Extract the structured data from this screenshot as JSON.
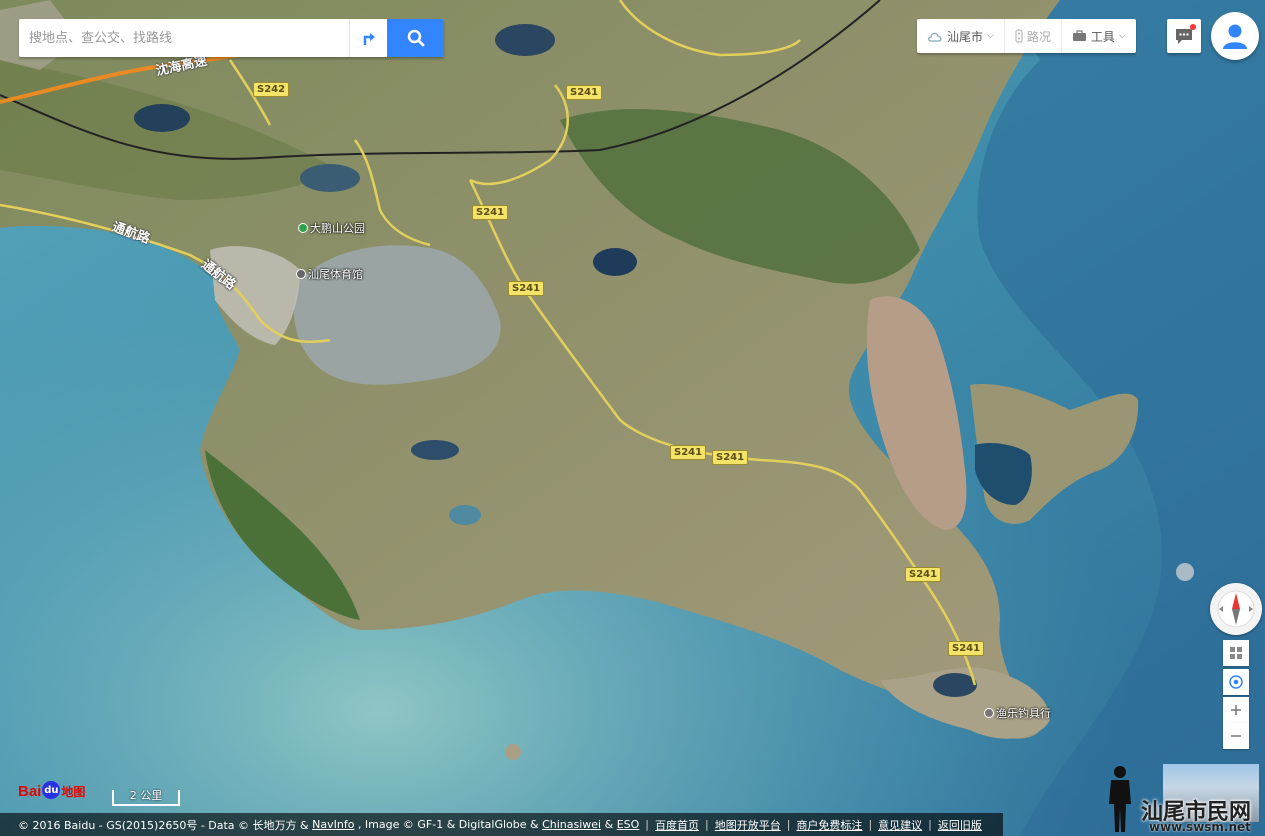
{
  "search": {
    "placeholder": "搜地点、查公交、找路线"
  },
  "toolbar": {
    "city": "汕尾市",
    "traffic": "路况",
    "tools": "工具"
  },
  "map": {
    "road_shields": [
      "S242",
      "S241",
      "S241",
      "S241",
      "S241",
      "S241",
      "S241",
      "S241"
    ],
    "road_names": {
      "expressway": "沈海高速",
      "tonghang_1": "通航路",
      "tonghang_2": "通航路"
    },
    "pois": {
      "park": "大鹏山公园",
      "stadium": "汕尾体育馆",
      "fishing": "渔乐钓具行"
    }
  },
  "scale": {
    "label": "2 公里"
  },
  "logo": {
    "bai": "Bai",
    "du": "du",
    "ditu": "地图"
  },
  "footer": {
    "copyright": "© 2016 Baidu - GS(2015)2650号 - Data © 长地万方 &",
    "navinfo": "NavInfo",
    "image": ", Image © GF-1 & DigitalGlobe &",
    "chinasiwei": "Chinasiwei",
    "amp": "&",
    "eso": "ESO",
    "links": [
      "百度首页",
      "地图开放平台",
      "商户免费标注",
      "意见建议",
      "返回旧版"
    ]
  },
  "watermark": {
    "text": "汕尾市民网",
    "url": "www.swsm.net"
  },
  "colors": {
    "search_button": "#3385ff",
    "sea": "#3d86a8",
    "road_shield": "#f3e469"
  }
}
